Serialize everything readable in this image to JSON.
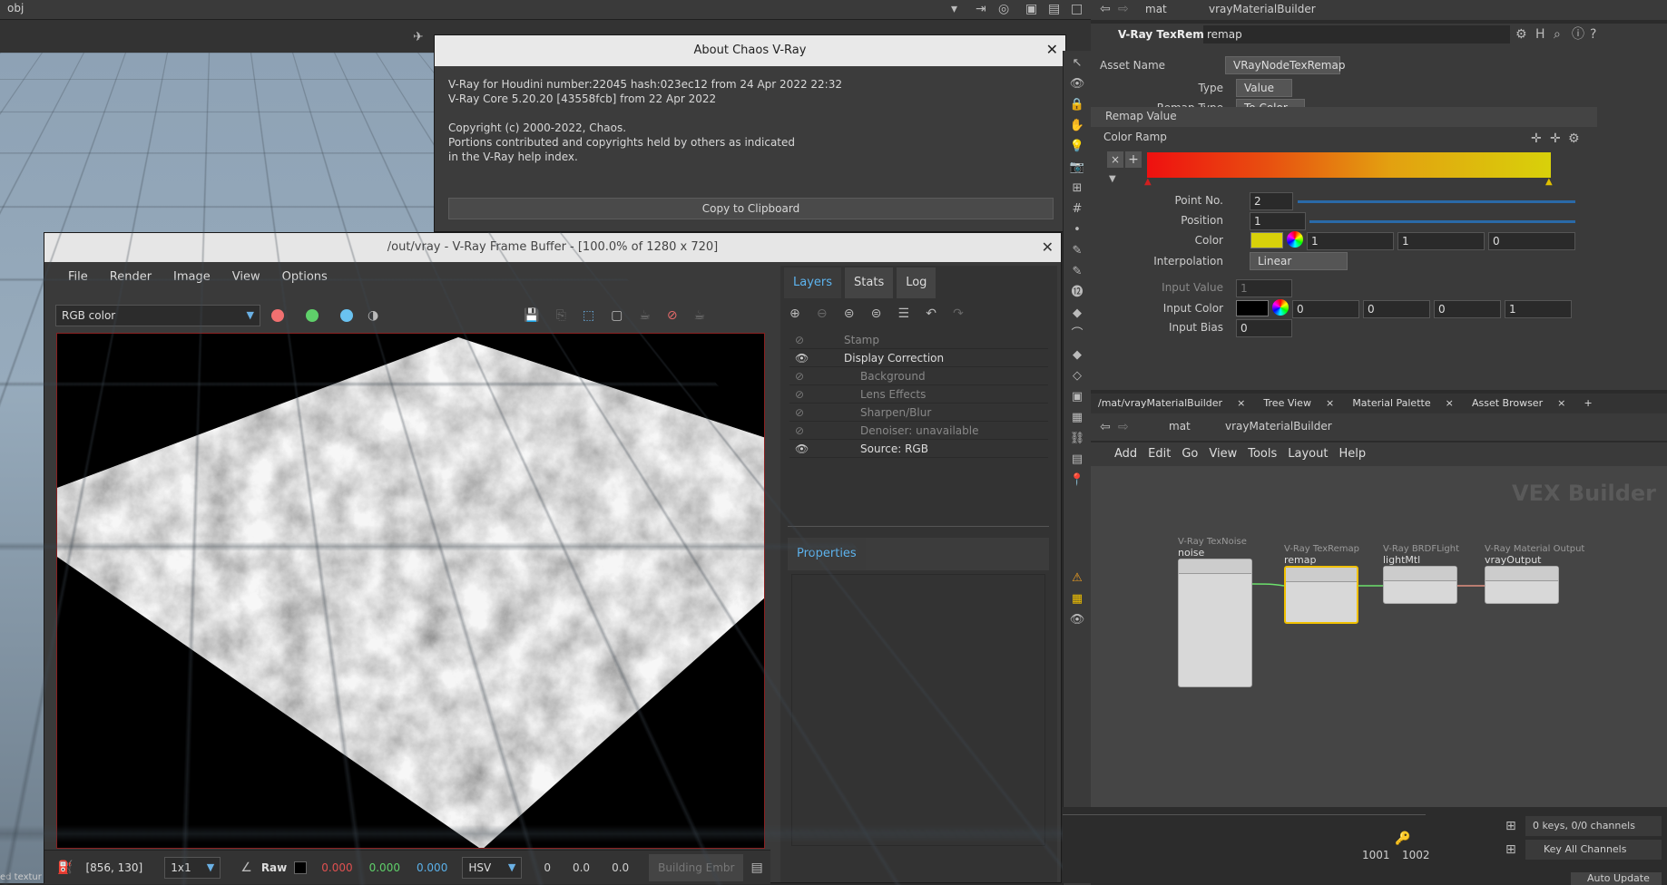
{
  "topbar": {
    "context": "obj"
  },
  "about": {
    "title": "About Chaos V-Ray",
    "line1": "V-Ray for Houdini number:22045 hash:023ec12 from 24 Apr 2022 22:32",
    "line2": "V-Ray Core 5.20.20 [43558fcb] from 22 Apr 2022",
    "line3": "Copyright (c) 2000-2022, Chaos.",
    "line4": "Portions contributed and copyrights held by others as indicated",
    "line5": "in the V-Ray help index.",
    "copy_label": "Copy to Clipboard"
  },
  "vfb": {
    "title": "/out/vray - V-Ray Frame Buffer - [100.0% of 1280 x 720]",
    "menu": [
      "File",
      "Render",
      "Image",
      "View",
      "Options"
    ],
    "channel": "RGB color",
    "status": {
      "coords": "[856, 130]",
      "zoom": "1x1",
      "raw": "Raw",
      "r": "0.000",
      "g": "0.000",
      "b": "0.000",
      "mode": "HSV",
      "h": "0",
      "s": "0.0",
      "v": "0.0",
      "build": "Building Embr"
    },
    "tabs": [
      "Layers",
      "Stats",
      "Log"
    ],
    "layers": [
      "Stamp",
      "Display Correction",
      "Background",
      "Lens Effects",
      "Sharpen/Blur",
      "Denoiser: unavailable",
      "Source: RGB"
    ],
    "properties_tab": "Properties"
  },
  "param": {
    "path_mat": "mat",
    "path_builder": "vrayMaterialBuilder",
    "node_type": "V-Ray TexRemap",
    "node_name": "remap",
    "asset_name_label": "Asset Name",
    "asset_name": "VRayNodeTexRemap",
    "type_label": "Type",
    "type_value": "Value",
    "remap_type_label": "Remap Type",
    "remap_type_value": "To Color",
    "section": "Remap Value",
    "color_ramp": "Color Ramp",
    "point_no_label": "Point No.",
    "point_no": "2",
    "position_label": "Position",
    "position": "1",
    "color_label": "Color",
    "color_r": "1",
    "color_g": "1",
    "color_b": "0",
    "interp_label": "Interpolation",
    "interp": "Linear",
    "input_value_label": "Input Value",
    "input_value": "1",
    "input_color_label": "Input Color",
    "ic": [
      "0",
      "0",
      "0",
      "1"
    ],
    "input_bias_label": "Input Bias",
    "input_bias": "0"
  },
  "net": {
    "tabs": [
      "/mat/vrayMaterialBuilder",
      "Tree View",
      "Material Palette",
      "Asset Browser"
    ],
    "path_mat": "mat",
    "path_builder": "vrayMaterialBuilder",
    "menu": [
      "Add",
      "Edit",
      "Go",
      "View",
      "Tools",
      "Layout",
      "Help"
    ],
    "watermark": "VEX Builder",
    "nodes": [
      {
        "type": "V-Ray TexNoise",
        "name": "noise"
      },
      {
        "type": "V-Ray TexRemap",
        "name": "remap"
      },
      {
        "type": "V-Ray BRDFLight",
        "name": "lightMtl"
      },
      {
        "type": "V-Ray Material Output",
        "name": "vrayOutput"
      }
    ]
  },
  "timeline": {
    "keys": "0 keys, 0/0 channels",
    "key_all": "Key All Channels",
    "f1": "1001",
    "f2": "1002",
    "auto_update": "Auto Update",
    "left_fragment": "ed textur"
  },
  "colors": {
    "accent": "#5db4ef",
    "ramp_start": "#ef1010",
    "ramp_end": "#d8d10a",
    "selected": "#f0c000"
  }
}
